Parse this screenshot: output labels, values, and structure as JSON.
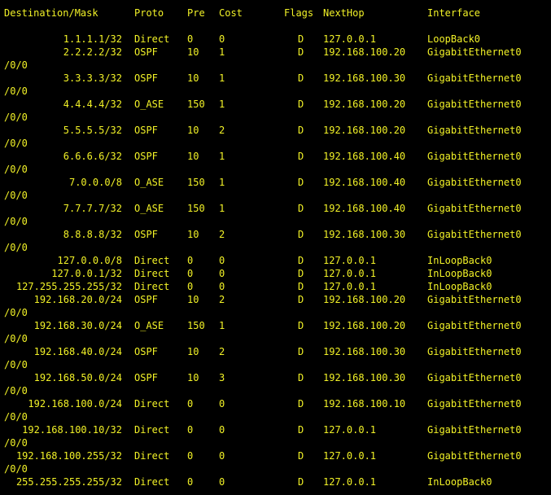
{
  "terminal": {
    "text_color": "#f2f227",
    "background": "#000000",
    "header": {
      "destination_mask": "Destination/Mask",
      "proto": "Proto",
      "pre": "Pre",
      "cost": "Cost",
      "flags": "Flags",
      "nexthop": "NextHop",
      "interface": "Interface"
    },
    "routes": [
      {
        "dest": "1.1.1.1/32",
        "proto": "Direct",
        "pre": "0",
        "cost": "0",
        "flags": "D",
        "nexthop": "127.0.0.1",
        "iface": "LoopBack0",
        "wrap": ""
      },
      {
        "dest": "2.2.2.2/32",
        "proto": "OSPF",
        "pre": "10",
        "cost": "1",
        "flags": "D",
        "nexthop": "192.168.100.20",
        "iface": "GigabitEthernet0",
        "wrap": "/0/0"
      },
      {
        "dest": "3.3.3.3/32",
        "proto": "OSPF",
        "pre": "10",
        "cost": "1",
        "flags": "D",
        "nexthop": "192.168.100.30",
        "iface": "GigabitEthernet0",
        "wrap": "/0/0"
      },
      {
        "dest": "4.4.4.4/32",
        "proto": "O_ASE",
        "pre": "150",
        "cost": "1",
        "flags": "D",
        "nexthop": "192.168.100.20",
        "iface": "GigabitEthernet0",
        "wrap": "/0/0"
      },
      {
        "dest": "5.5.5.5/32",
        "proto": "OSPF",
        "pre": "10",
        "cost": "2",
        "flags": "D",
        "nexthop": "192.168.100.20",
        "iface": "GigabitEthernet0",
        "wrap": "/0/0"
      },
      {
        "dest": "6.6.6.6/32",
        "proto": "OSPF",
        "pre": "10",
        "cost": "1",
        "flags": "D",
        "nexthop": "192.168.100.40",
        "iface": "GigabitEthernet0",
        "wrap": "/0/0"
      },
      {
        "dest": "7.0.0.0/8",
        "proto": "O_ASE",
        "pre": "150",
        "cost": "1",
        "flags": "D",
        "nexthop": "192.168.100.40",
        "iface": "GigabitEthernet0",
        "wrap": "/0/0"
      },
      {
        "dest": "7.7.7.7/32",
        "proto": "O_ASE",
        "pre": "150",
        "cost": "1",
        "flags": "D",
        "nexthop": "192.168.100.40",
        "iface": "GigabitEthernet0",
        "wrap": "/0/0"
      },
      {
        "dest": "8.8.8.8/32",
        "proto": "OSPF",
        "pre": "10",
        "cost": "2",
        "flags": "D",
        "nexthop": "192.168.100.30",
        "iface": "GigabitEthernet0",
        "wrap": "/0/0"
      },
      {
        "dest": "127.0.0.0/8",
        "proto": "Direct",
        "pre": "0",
        "cost": "0",
        "flags": "D",
        "nexthop": "127.0.0.1",
        "iface": "InLoopBack0",
        "wrap": ""
      },
      {
        "dest": "127.0.0.1/32",
        "proto": "Direct",
        "pre": "0",
        "cost": "0",
        "flags": "D",
        "nexthop": "127.0.0.1",
        "iface": "InLoopBack0",
        "wrap": ""
      },
      {
        "dest": "127.255.255.255/32",
        "proto": "Direct",
        "pre": "0",
        "cost": "0",
        "flags": "D",
        "nexthop": "127.0.0.1",
        "iface": "InLoopBack0",
        "wrap": ""
      },
      {
        "dest": "192.168.20.0/24",
        "proto": "OSPF",
        "pre": "10",
        "cost": "2",
        "flags": "D",
        "nexthop": "192.168.100.20",
        "iface": "GigabitEthernet0",
        "wrap": "/0/0"
      },
      {
        "dest": "192.168.30.0/24",
        "proto": "O_ASE",
        "pre": "150",
        "cost": "1",
        "flags": "D",
        "nexthop": "192.168.100.20",
        "iface": "GigabitEthernet0",
        "wrap": "/0/0"
      },
      {
        "dest": "192.168.40.0/24",
        "proto": "OSPF",
        "pre": "10",
        "cost": "2",
        "flags": "D",
        "nexthop": "192.168.100.30",
        "iface": "GigabitEthernet0",
        "wrap": "/0/0"
      },
      {
        "dest": "192.168.50.0/24",
        "proto": "OSPF",
        "pre": "10",
        "cost": "3",
        "flags": "D",
        "nexthop": "192.168.100.30",
        "iface": "GigabitEthernet0",
        "wrap": "/0/0"
      },
      {
        "dest": "192.168.100.0/24",
        "proto": "Direct",
        "pre": "0",
        "cost": "0",
        "flags": "D",
        "nexthop": "192.168.100.10",
        "iface": "GigabitEthernet0",
        "wrap": "/0/0"
      },
      {
        "dest": "192.168.100.10/32",
        "proto": "Direct",
        "pre": "0",
        "cost": "0",
        "flags": "D",
        "nexthop": "127.0.0.1",
        "iface": "GigabitEthernet0",
        "wrap": "/0/0"
      },
      {
        "dest": "192.168.100.255/32",
        "proto": "Direct",
        "pre": "0",
        "cost": "0",
        "flags": "D",
        "nexthop": "127.0.0.1",
        "iface": "GigabitEthernet0",
        "wrap": "/0/0"
      },
      {
        "dest": "255.255.255.255/32",
        "proto": "Direct",
        "pre": "0",
        "cost": "0",
        "flags": "D",
        "nexthop": "127.0.0.1",
        "iface": "InLoopBack0",
        "wrap": ""
      }
    ]
  }
}
